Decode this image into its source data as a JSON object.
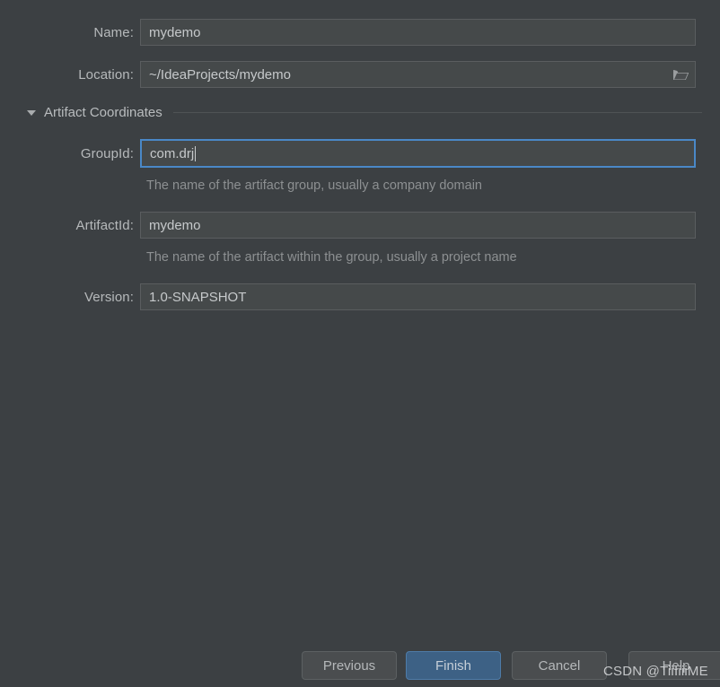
{
  "theme": {
    "background": "#3c4043",
    "field_background": "#45494a",
    "field_border": "#5a5d5f",
    "focus_border": "#4a88c7",
    "label_color": "#b6b9bb",
    "helper_color": "#8d9092",
    "primary_button": "#3d6185"
  },
  "form": {
    "name": {
      "label": "Name:",
      "value": "mydemo"
    },
    "location": {
      "label": "Location:",
      "value": "~/IdeaProjects/mydemo",
      "browse_icon": "folder-icon"
    },
    "artifact_section": {
      "title": "Artifact Coordinates",
      "disclosure_icon": "chevron-down-icon",
      "expanded": true
    },
    "group_id": {
      "label": "GroupId:",
      "value": "com.drj",
      "focused": true,
      "helper": "The name of the artifact group, usually a company domain"
    },
    "artifact_id": {
      "label": "ArtifactId:",
      "value": "mydemo",
      "focused": false,
      "helper": "The name of the artifact within the group, usually a project name"
    },
    "version": {
      "label": "Version:",
      "value": "1.0-SNAPSHOT",
      "focused": false
    }
  },
  "buttons": {
    "previous": "Previous",
    "finish": "Finish",
    "cancel": "Cancel",
    "help": "Help"
  },
  "watermark": {
    "text": "CSDN @TiiIiiiME"
  }
}
